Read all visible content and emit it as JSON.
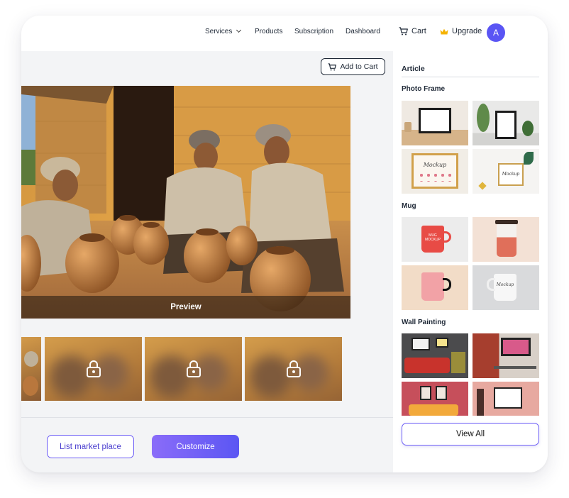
{
  "nav": {
    "services": "Services",
    "products": "Products",
    "subscription": "Subscription",
    "dashboard": "Dashboard",
    "cart": "Cart",
    "upgrade": "Upgrade",
    "avatar_initial": "A"
  },
  "main": {
    "add_to_cart": "Add to Cart",
    "preview_label": "Preview",
    "list_market_place": "List market place",
    "customize": "Customize"
  },
  "side": {
    "title": "Article",
    "sections": [
      "Photo Frame",
      "Mug",
      "Wall Painting"
    ],
    "view_all": "View All"
  },
  "mockups": {
    "frame_card_1": "Mockup",
    "frame_card_2": "Mockup",
    "mug_text_1": "MUG MOCKUP",
    "mug_text_2": "Mockup"
  },
  "colors": {
    "accent": "#5a55f4",
    "accent_light": "#8a6cf9",
    "crown": "#f5b301"
  }
}
